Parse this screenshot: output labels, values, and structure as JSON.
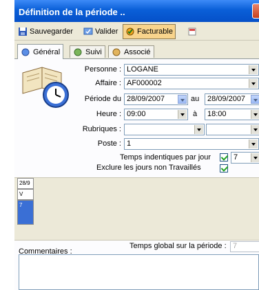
{
  "window": {
    "title": "Définition de la période .."
  },
  "toolbar": {
    "save_label": "Sauvegarder",
    "validate_label": "Valider",
    "billable_label": "Facturable"
  },
  "tabs": [
    {
      "label": "Général"
    },
    {
      "label": "Suivi"
    },
    {
      "label": "Associé"
    }
  ],
  "form": {
    "personne_label": "Personne :",
    "personne_value": "LOGANE",
    "affaire_label": "Affaire :",
    "affaire_value": "AF000002",
    "periode_label": "Période du",
    "date_from": "28/09/2007",
    "au_label": "au",
    "date_to": "28/09/2007",
    "heure_label": "Heure :",
    "time_from": "09:00",
    "a_label": "à",
    "time_to": "18:00",
    "rubriques_label": "Rubriques :",
    "rubriques_value1": "",
    "rubriques_value2": "",
    "poste_label": "Poste :",
    "poste_value": "1",
    "identical_label": "Temps indentiques par jour",
    "identical_checked": true,
    "identical_value": "7",
    "exclude_label": "Exclure les jours non Travaillés",
    "exclude_checked": true
  },
  "calendar": {
    "date": "28/9",
    "day": "V",
    "hours": "7"
  },
  "footer": {
    "total_label": "Temps global sur la période :",
    "total_value": "7",
    "comment_label": "Commentaires :"
  }
}
